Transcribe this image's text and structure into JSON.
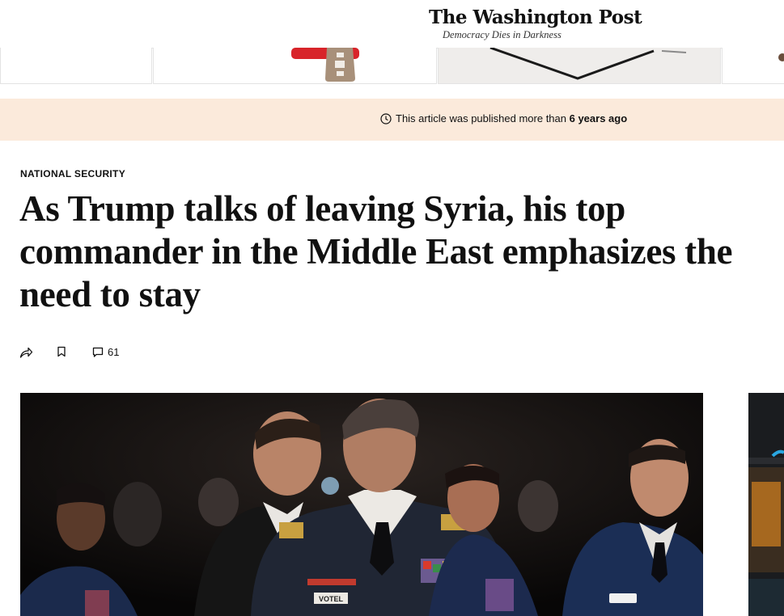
{
  "masthead": {
    "logo": "The Washington Post",
    "tagline": "Democracy Dies in Darkness"
  },
  "notice": {
    "prefix": "This article was published more than ",
    "age": "6 years ago"
  },
  "article": {
    "kicker": "NATIONAL SECURITY",
    "headline": "As Trump talks of leaving Syria, his top commander in the Middle East emphasizes the need to stay"
  },
  "actions": {
    "comment_count": "61"
  },
  "photo": {
    "nameplate": "VOTEL"
  },
  "colors": {
    "notice_bg": "#fbeadb",
    "text": "#111111"
  }
}
